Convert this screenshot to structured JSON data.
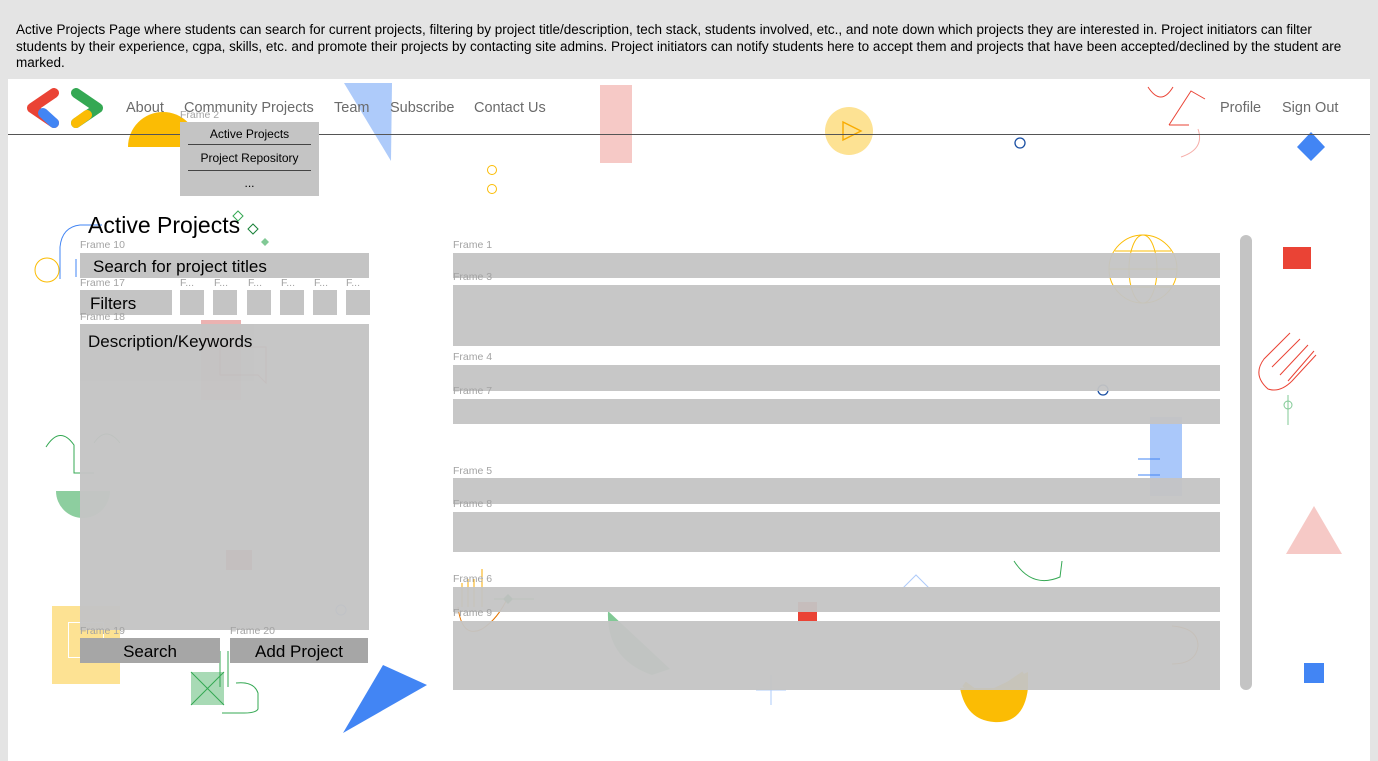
{
  "description": "Active Projects Page where students can search for current projects, filtering by project title/description, tech stack, students involved, etc., and note down which projects they are interested in. Project initiators can filter students by their experience, cgpa, skills, etc. and promote their projects by contacting site admins. Project initiators can notify students here to accept them and projects that have been accepted/declined by the student are marked.",
  "nav": {
    "links": [
      "About",
      "Community Projects",
      "Team",
      "Subscribe",
      "Contact Us"
    ],
    "right": [
      "Profile",
      "Sign Out"
    ]
  },
  "dropdown": {
    "frame_label": "Frame 2",
    "items": [
      "Active Projects",
      "Project Repository",
      "..."
    ]
  },
  "left": {
    "title": "Active Projects",
    "search_frame_label": "Frame 10",
    "search_placeholder": "Search for project titles",
    "filters_frame_label": "Frame 17",
    "filters_label": "Filters",
    "filter_chips": [
      "F...",
      "F...",
      "F...",
      "F...",
      "F...",
      "F..."
    ],
    "desc_frame_label": "Frame 18",
    "desc_placeholder": "Description/Keywords",
    "search_button_frame": "Frame 19",
    "search_button": "Search",
    "add_button_frame": "Frame 20",
    "add_button": "Add Project"
  },
  "projects": [
    {
      "label": "Frame 1"
    },
    {
      "label": "Frame 3"
    },
    {
      "label": "Frame 4"
    },
    {
      "label": "Frame 7"
    },
    {
      "label": "Frame 5"
    },
    {
      "label": "Frame 8"
    },
    {
      "label": "Frame 6"
    },
    {
      "label": "Frame 9"
    }
  ],
  "colors": {
    "blue": "#4285f4",
    "red": "#ea4335",
    "yellow": "#fbbc04",
    "green": "#34a853",
    "placeholder_gray": "#c4c4c4",
    "button_gray": "#a6a6a6"
  }
}
